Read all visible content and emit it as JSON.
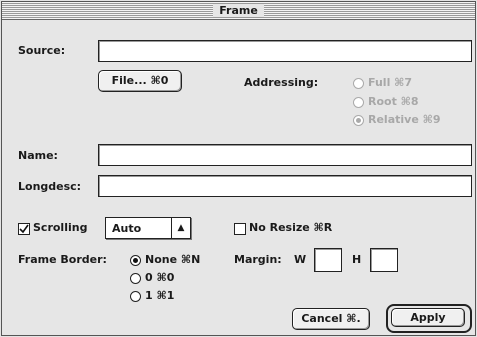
{
  "window": {
    "title": "Frame"
  },
  "source": {
    "label": "Source:",
    "value": ""
  },
  "file_button": {
    "label": "File... ⌘0"
  },
  "addressing": {
    "label": "Addressing:",
    "options": [
      {
        "label": "Full ⌘7",
        "selected": false
      },
      {
        "label": "Root ⌘8",
        "selected": false
      },
      {
        "label": "Relative ⌘9",
        "selected": true
      }
    ]
  },
  "name": {
    "label": "Name:",
    "value": ""
  },
  "longdesc": {
    "label": "Longdesc:",
    "value": ""
  },
  "scrolling": {
    "label": "Scrolling",
    "checked": true,
    "selected_value": "Auto"
  },
  "no_resize": {
    "label": "No Resize ⌘R",
    "checked": false
  },
  "frame_border": {
    "label": "Frame Border:",
    "options": [
      {
        "label": "None ⌘N",
        "selected": true
      },
      {
        "label": "0 ⌘0",
        "selected": false
      },
      {
        "label": "1 ⌘1",
        "selected": false
      }
    ]
  },
  "margin": {
    "label": "Margin:",
    "w_label": "W",
    "h_label": "H",
    "w_value": "",
    "h_value": ""
  },
  "buttons": {
    "cancel": "Cancel ⌘.",
    "apply": "Apply"
  }
}
